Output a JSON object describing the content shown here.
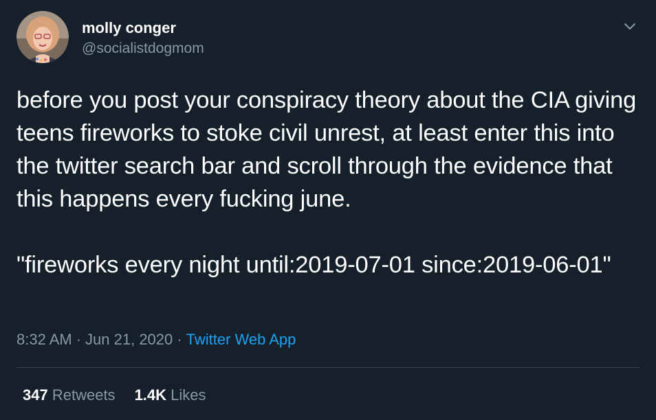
{
  "user": {
    "display_name": "molly conger",
    "handle": "@socialistdogmom"
  },
  "tweet": {
    "paragraph_1": "before you post your conspiracy theory about the CIA giving teens fireworks to stoke civil unrest, at least enter this into the twitter search bar and scroll through the evidence that this happens every fucking june.",
    "paragraph_2": "\"fireworks every night until:2019-07-01 since:2019-06-01\""
  },
  "meta": {
    "time": "8:32 AM",
    "separator": "·",
    "date": "Jun 21, 2020",
    "source": "Twitter Web App"
  },
  "stats": {
    "retweets_count": "347",
    "retweets_label": "Retweets",
    "likes_count": "1.4K",
    "likes_label": "Likes"
  },
  "icons": {
    "menu": "chevron-down-icon",
    "avatar": "avatar"
  },
  "colors": {
    "background": "#15202b",
    "text": "#ffffff",
    "secondary_text": "#8899a6",
    "link": "#1da1f2",
    "divider": "#38444d"
  }
}
